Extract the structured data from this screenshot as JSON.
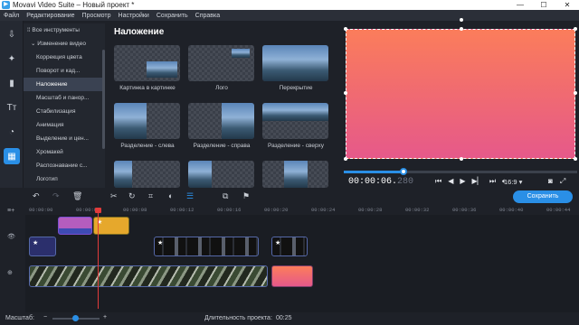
{
  "window": {
    "title": "Movavi Video Suite – Новый проект *",
    "controls": [
      "—",
      "☐",
      "✕"
    ]
  },
  "menu": [
    "Файл",
    "Редактирование",
    "Просмотр",
    "Настройки",
    "Сохранить",
    "Справка"
  ],
  "leftbar": [
    {
      "icon": "import-icon",
      "glyph": "⇩"
    },
    {
      "icon": "magic-icon",
      "glyph": "✦"
    },
    {
      "icon": "transitions-icon",
      "glyph": "▮"
    },
    {
      "icon": "titles-icon",
      "glyph": "Tт"
    },
    {
      "icon": "stickers-icon",
      "glyph": "◔"
    },
    {
      "icon": "more-tools-icon",
      "glyph": "▦"
    }
  ],
  "tools": {
    "all": "Все инструменты",
    "group": "Изменение видео",
    "items": [
      "Коррекция цвета",
      "Поворот и кад...",
      "Наложение",
      "Масштаб и панор...",
      "Стабилизация",
      "Анимация",
      "Выделение и цен...",
      "Хромакей",
      "Распознавание с...",
      "Логотип"
    ],
    "selected_index": 2
  },
  "gallery": {
    "title": "Наложение",
    "tiles": [
      "Картинка в картинке",
      "Лого",
      "Перекрытие",
      "Разделение - слева",
      "Разделение - справа",
      "Разделение - сверху",
      "",
      ""
    ]
  },
  "player": {
    "timecode_main": "00:00:06.",
    "timecode_ms": "280",
    "ratio": "16:9 ▾",
    "progress": 0.25,
    "transport": [
      "⏮",
      "◀",
      "▶",
      "▶▏",
      "⏭"
    ],
    "icons": [
      "camera-icon",
      "fullscreen-icon"
    ]
  },
  "toolbar": {
    "save_label": "Сохранить"
  },
  "ruler": [
    "00:00:00",
    "00:00:04",
    "00:00:08",
    "00:00:12",
    "00:00:16",
    "00:00:20",
    "00:00:24",
    "00:00:28",
    "00:00:32",
    "00:00:36",
    "00:00:40",
    "00:00:44"
  ],
  "status": {
    "zoom_label": "Масштаб:",
    "duration_label": "Длительность проекта:",
    "duration_value": "00:25"
  },
  "colors": {
    "accent": "#2a8fe6",
    "playhead": "#e23b3b",
    "preview_top": "#fb7d5b",
    "preview_bottom": "#e6598a"
  }
}
